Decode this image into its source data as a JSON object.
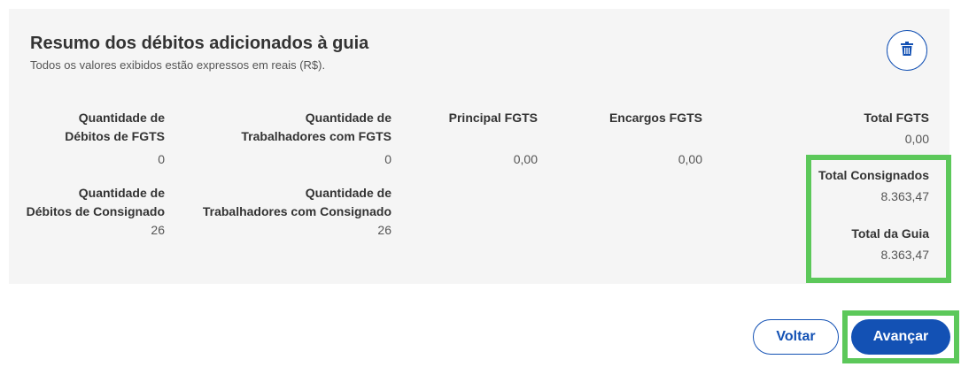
{
  "summary": {
    "title": "Resumo dos débitos adicionados à guia",
    "subtitle": "Todos os valores exibidos estão expressos em reais (R$).",
    "delete_icon": "trash-icon",
    "fgts": {
      "qtd_debitos_label_1": "Quantidade de",
      "qtd_debitos_label_2": "Débitos de FGTS",
      "qtd_debitos_value": "0",
      "qtd_trab_label_1": "Quantidade de",
      "qtd_trab_label_2": "Trabalhadores com FGTS",
      "qtd_trab_value": "0",
      "principal_label": "Principal FGTS",
      "principal_value": "0,00",
      "encargos_label": "Encargos FGTS",
      "encargos_value": "0,00",
      "total_label": "Total FGTS",
      "total_value": "0,00"
    },
    "consignado": {
      "qtd_debitos_label_1": "Quantidade de",
      "qtd_debitos_label_2": "Débitos de Consignado",
      "qtd_debitos_value": "26",
      "qtd_trab_label_1": "Quantidade de",
      "qtd_trab_label_2": "Trabalhadores com Consignado",
      "qtd_trab_value": "26",
      "total_label": "Total Consignados",
      "total_value": "8.363,47"
    },
    "guia": {
      "total_label": "Total da Guia",
      "total_value": "8.363,47"
    }
  },
  "actions": {
    "back_label": "Voltar",
    "next_label": "Avançar"
  },
  "colors": {
    "primary": "#1351b4",
    "highlight": "#5cc85a",
    "panel_bg": "#f5f5f5"
  }
}
